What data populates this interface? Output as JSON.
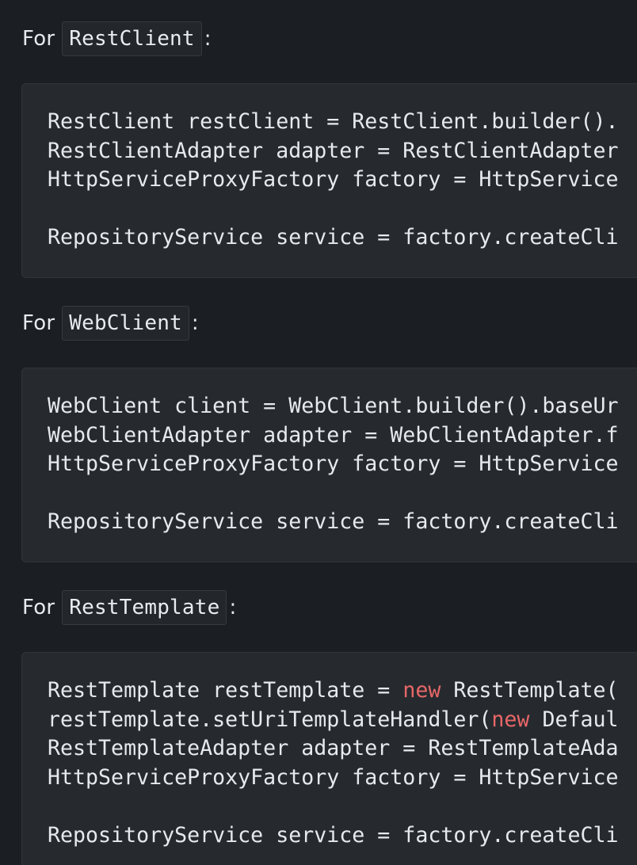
{
  "sections": [
    {
      "heading_prefix": "For",
      "heading_code": "RestClient",
      "heading_suffix": ":",
      "code_lines": [
        [
          {
            "t": "RestClient restClient = RestClient.builder()."
          }
        ],
        [
          {
            "t": "RestClientAdapter adapter = RestClientAdapter"
          }
        ],
        [
          {
            "t": "HttpServiceProxyFactory factory = HttpService"
          }
        ],
        [
          {
            "t": ""
          }
        ],
        [
          {
            "t": "RepositoryService service = factory.createCli"
          }
        ]
      ]
    },
    {
      "heading_prefix": "For",
      "heading_code": "WebClient",
      "heading_suffix": ":",
      "code_lines": [
        [
          {
            "t": "WebClient client = WebClient.builder().baseUr"
          }
        ],
        [
          {
            "t": "WebClientAdapter adapter = WebClientAdapter.f"
          }
        ],
        [
          {
            "t": "HttpServiceProxyFactory factory = HttpService"
          }
        ],
        [
          {
            "t": ""
          }
        ],
        [
          {
            "t": "RepositoryService service = factory.createCli"
          }
        ]
      ]
    },
    {
      "heading_prefix": "For",
      "heading_code": "RestTemplate",
      "heading_suffix": ":",
      "code_lines": [
        [
          {
            "t": "RestTemplate restTemplate = "
          },
          {
            "t": "new",
            "kw": true
          },
          {
            "t": " RestTemplate("
          }
        ],
        [
          {
            "t": "restTemplate.setUriTemplateHandler("
          },
          {
            "t": "new",
            "kw": true
          },
          {
            "t": " Defaul"
          }
        ],
        [
          {
            "t": "RestTemplateAdapter adapter = RestTemplateAda"
          }
        ],
        [
          {
            "t": "HttpServiceProxyFactory factory = HttpService"
          }
        ],
        [
          {
            "t": ""
          }
        ],
        [
          {
            "t": "RepositoryService service = factory.createCli"
          }
        ]
      ]
    }
  ],
  "colors": {
    "background": "#1b1e22",
    "code_background": "#262a2f",
    "keyword": "#e86767",
    "text": "#e6e9ed"
  }
}
